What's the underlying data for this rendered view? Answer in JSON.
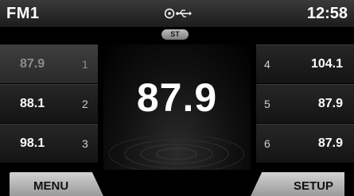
{
  "status": {
    "band": "FM1",
    "clock": "12:58",
    "icons": [
      "disc-icon",
      "usb-icon"
    ]
  },
  "stereo_badge": "ST",
  "current_frequency": "87.9",
  "presets_left": [
    {
      "frequency": "87.9",
      "number": "1",
      "selected": true
    },
    {
      "frequency": "88.1",
      "number": "2",
      "selected": false
    },
    {
      "frequency": "98.1",
      "number": "3",
      "selected": false
    }
  ],
  "presets_right": [
    {
      "frequency": "104.1",
      "number": "4",
      "selected": false
    },
    {
      "frequency": "87.9",
      "number": "5",
      "selected": false
    },
    {
      "frequency": "87.9",
      "number": "6",
      "selected": false
    }
  ],
  "softkeys": {
    "menu_label": "MENU",
    "setup_label": "SETUP"
  }
}
